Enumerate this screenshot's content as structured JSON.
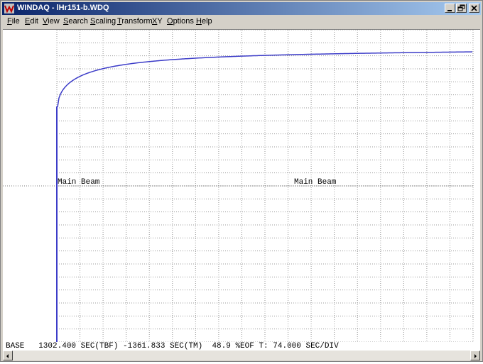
{
  "window": {
    "title": "WINDAQ - lHr151-b.WDQ",
    "app_icon": "windaq-icon"
  },
  "menu": [
    {
      "label": "File",
      "key": "F",
      "rest": "ile"
    },
    {
      "label": "Edit",
      "key": "E",
      "rest": "dit"
    },
    {
      "label": "View",
      "key": "V",
      "rest": "iew"
    },
    {
      "label": "Search",
      "key": "S",
      "rest": "earch"
    },
    {
      "label": "Scaling",
      "key": "S",
      "rest": "caling"
    },
    {
      "label": "Transform",
      "key": "T",
      "rest": "ransform"
    },
    {
      "label": "XY",
      "key": "X",
      "rest": "Y"
    },
    {
      "label": "Options",
      "key": "O",
      "rest": "ptions"
    },
    {
      "label": "Help",
      "key": "H",
      "rest": "elp"
    }
  ],
  "channel_labels": {
    "left": "Main Beam",
    "right": "Main Beam"
  },
  "status": {
    "text": "BASE   1302.400 SEC(TBF) -1361.833 SEC(TM)  48.9 %EOF T: 74.000 SEC/DIV"
  },
  "colors": {
    "titlebar_start": "#0a246a",
    "titlebar_end": "#a6caf0",
    "trace": "#3c3cc8",
    "grid": "#9a9a9a"
  }
}
